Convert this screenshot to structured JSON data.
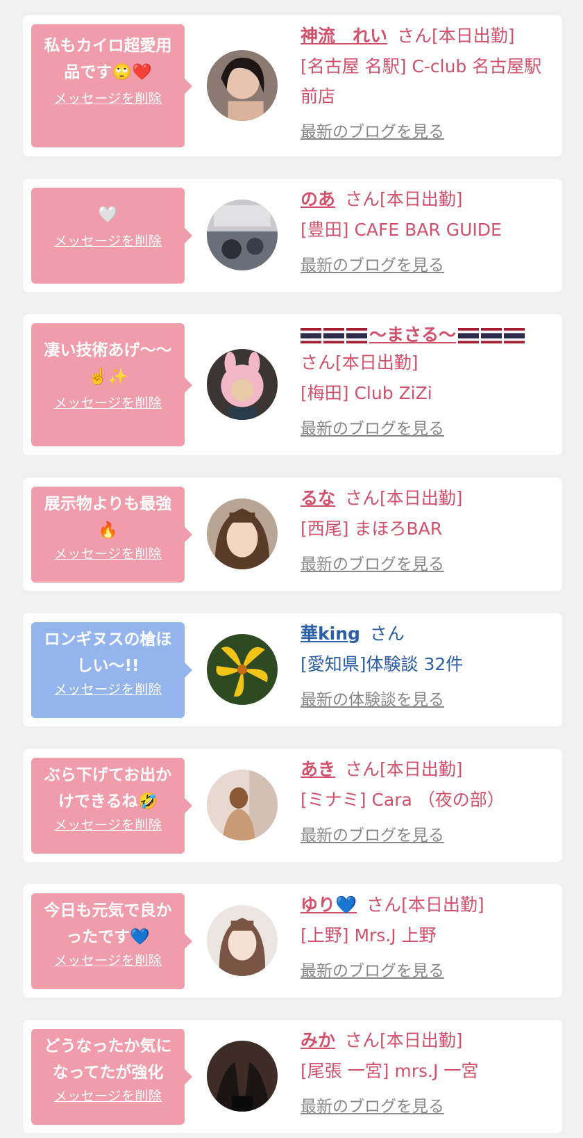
{
  "delete_label": "メッセージを削除",
  "cards": [
    {
      "message_text": "私もカイロ超愛用品です",
      "message_emoji": "🙄❤️",
      "name": "神流　れい",
      "suffix": "さん[本日出勤]",
      "shop": "[名古屋 名駅] C-club 名古屋駅前店",
      "link": "最新のブログを見る"
    },
    {
      "message_text": "",
      "message_emoji": "🤍",
      "name": "のあ",
      "suffix": "さん[本日出勤]",
      "shop": "[豊田] CAFE BAR GUIDE",
      "link": "最新のブログを見る"
    },
    {
      "message_text": "凄い技術あげ〜〜",
      "message_emoji": "☝️✨",
      "name": "〜まさる〜",
      "suffix": "さん[本日出勤]",
      "shop": "[梅田] Club ZiZi",
      "link": "最新のブログを見る"
    },
    {
      "message_text": "展示物よりも最強",
      "message_emoji": "🔥",
      "name": "るな",
      "suffix": "さん[本日出勤]",
      "shop": "[西尾] まほろBAR",
      "link": "最新のブログを見る"
    },
    {
      "message_text": "ロンギヌスの槍ほしい〜!!",
      "message_emoji": "",
      "name": "華king",
      "suffix": "さん",
      "shop": "[愛知県]体験談 32件",
      "link": "最新の体験談を見る"
    },
    {
      "message_text": "ぶら下げてお出かけできるね",
      "message_emoji": "🤣",
      "name": "あき",
      "suffix": "さん[本日出勤]",
      "shop": "[ミナミ] Cara （夜の部）",
      "link": "最新のブログを見る"
    },
    {
      "message_text": "今日も元気で良かったです",
      "message_emoji": "💙",
      "name": "ゆり",
      "name_emoji": "💙",
      "suffix": "さん[本日出勤]",
      "shop": "[上野] Mrs.J 上野",
      "link": "最新のブログを見る"
    },
    {
      "message_text": "どうなったか気になってたが強化",
      "message_emoji": "",
      "name": "みか",
      "suffix": "さん[本日出勤]",
      "shop": "[尾張 一宮] mrs.J 一宮",
      "link": "最新のブログを見る"
    }
  ],
  "colors": {
    "pink_bubble": "#f09cab",
    "blue_bubble": "#93b4ec",
    "pink_text": "#d2506a",
    "blue_text": "#2c5ea8",
    "page_bg": "#f0f0f0"
  }
}
